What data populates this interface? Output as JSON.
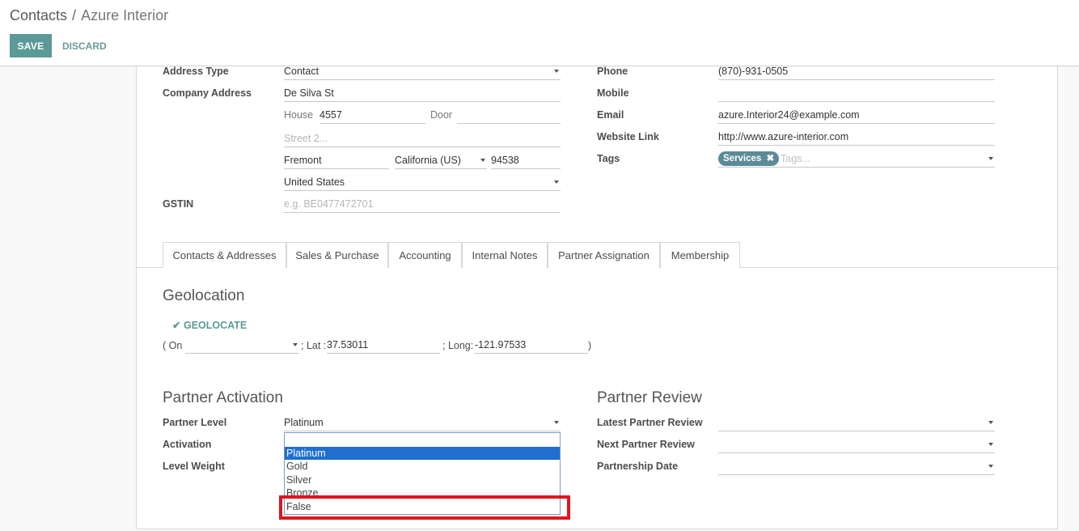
{
  "breadcrumb": {
    "parent": "Contacts",
    "separator": "/",
    "current": "Azure Interior"
  },
  "actions": {
    "save": "SAVE",
    "discard": "DISCARD"
  },
  "left_fields": {
    "address_type": {
      "label": "Address Type",
      "value": "Contact"
    },
    "company_address": {
      "label": "Company Address",
      "street": "De Silva St",
      "house_label": "House",
      "house": "4557",
      "door_label": "Door",
      "door": "",
      "street2_placeholder": "Street 2...",
      "city": "Fremont",
      "state": "California (US)",
      "zip": "94538",
      "country": "United States"
    },
    "gstin": {
      "label": "GSTIN",
      "placeholder": "e.g. BE0477472701"
    }
  },
  "right_fields": {
    "phone": {
      "label": "Phone",
      "value": "(870)-931-0505"
    },
    "mobile": {
      "label": "Mobile",
      "value": ""
    },
    "email": {
      "label": "Email",
      "value": "azure.Interior24@example.com"
    },
    "website": {
      "label": "Website Link",
      "value": "http://www.azure-interior.com"
    },
    "tags": {
      "label": "Tags",
      "tag": "Services",
      "placeholder": "Tags..."
    }
  },
  "tabs": [
    "Contacts & Addresses",
    "Sales & Purchase",
    "Accounting",
    "Internal Notes",
    "Partner Assignation",
    "Membership"
  ],
  "active_tab": "Partner Assignation",
  "geolocation": {
    "title": "Geolocation",
    "button": "GEOLOCATE",
    "on_label": "( On",
    "lat_label": "; Lat :",
    "lat": "37.53011",
    "long_label": "; Long:",
    "long": "-121.97533",
    "close_paren": ")"
  },
  "partner_activation": {
    "title": "Partner Activation",
    "level_label": "Partner Level",
    "level_value": "Platinum",
    "activation_label": "Activation",
    "weight_label": "Level Weight",
    "dropdown_options": [
      "Platinum",
      "Gold",
      "Silver",
      "Bronze",
      "False"
    ],
    "dropdown_selected": "Platinum"
  },
  "partner_review": {
    "title": "Partner Review",
    "latest_label": "Latest Partner Review",
    "next_label": "Next Partner Review",
    "date_label": "Partnership Date"
  },
  "colors": {
    "accent": "#5b9a98",
    "highlight": "#e0161e",
    "selection": "#1e6fd0"
  }
}
